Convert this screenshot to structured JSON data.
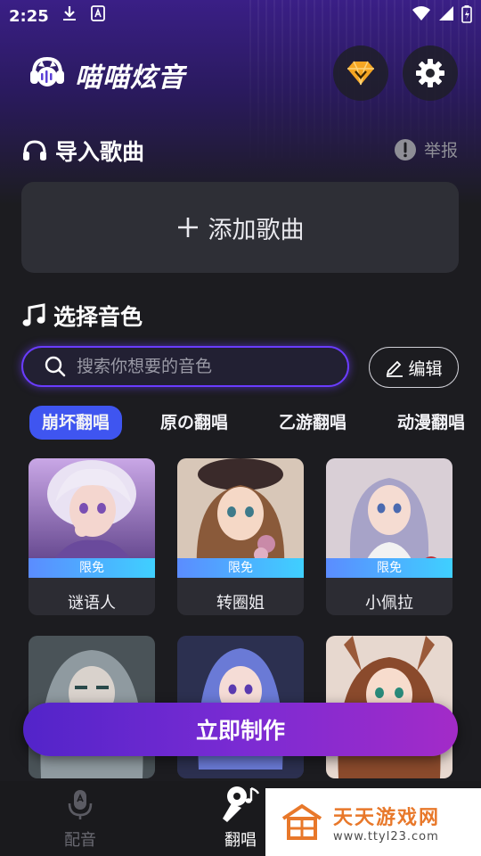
{
  "status_bar": {
    "time": "2:25"
  },
  "header": {
    "app_title": "喵喵炫音"
  },
  "import_section": {
    "title": "导入歌曲",
    "report_label": "举报",
    "add_song_label": "添加歌曲"
  },
  "voice_section": {
    "title": "选择音色",
    "search_placeholder": "搜索你想要的音色",
    "edit_label": "编辑",
    "tabs": [
      "崩坏翻唱",
      "原の翻唱",
      "乙游翻唱",
      "动漫翻唱"
    ],
    "active_tab": "崩坏翻唱"
  },
  "voices": [
    {
      "name": "谜语人",
      "badge": "限免"
    },
    {
      "name": "转圈姐",
      "badge": "限免"
    },
    {
      "name": "小佩拉",
      "badge": "限免"
    }
  ],
  "make_button_label": "立即制作",
  "bottom_nav": [
    {
      "label": "配音",
      "icon": "microphone-icon",
      "active": false
    },
    {
      "label": "翻唱",
      "icon": "karaoke-mic-icon",
      "active": true
    }
  ],
  "watermark": {
    "title": "天天游戏网",
    "url": "www.ttyl23.com"
  },
  "colors": {
    "accent": "#3f55f0",
    "badge": "#3fd0ff",
    "make_button": "#7a2bd3"
  }
}
